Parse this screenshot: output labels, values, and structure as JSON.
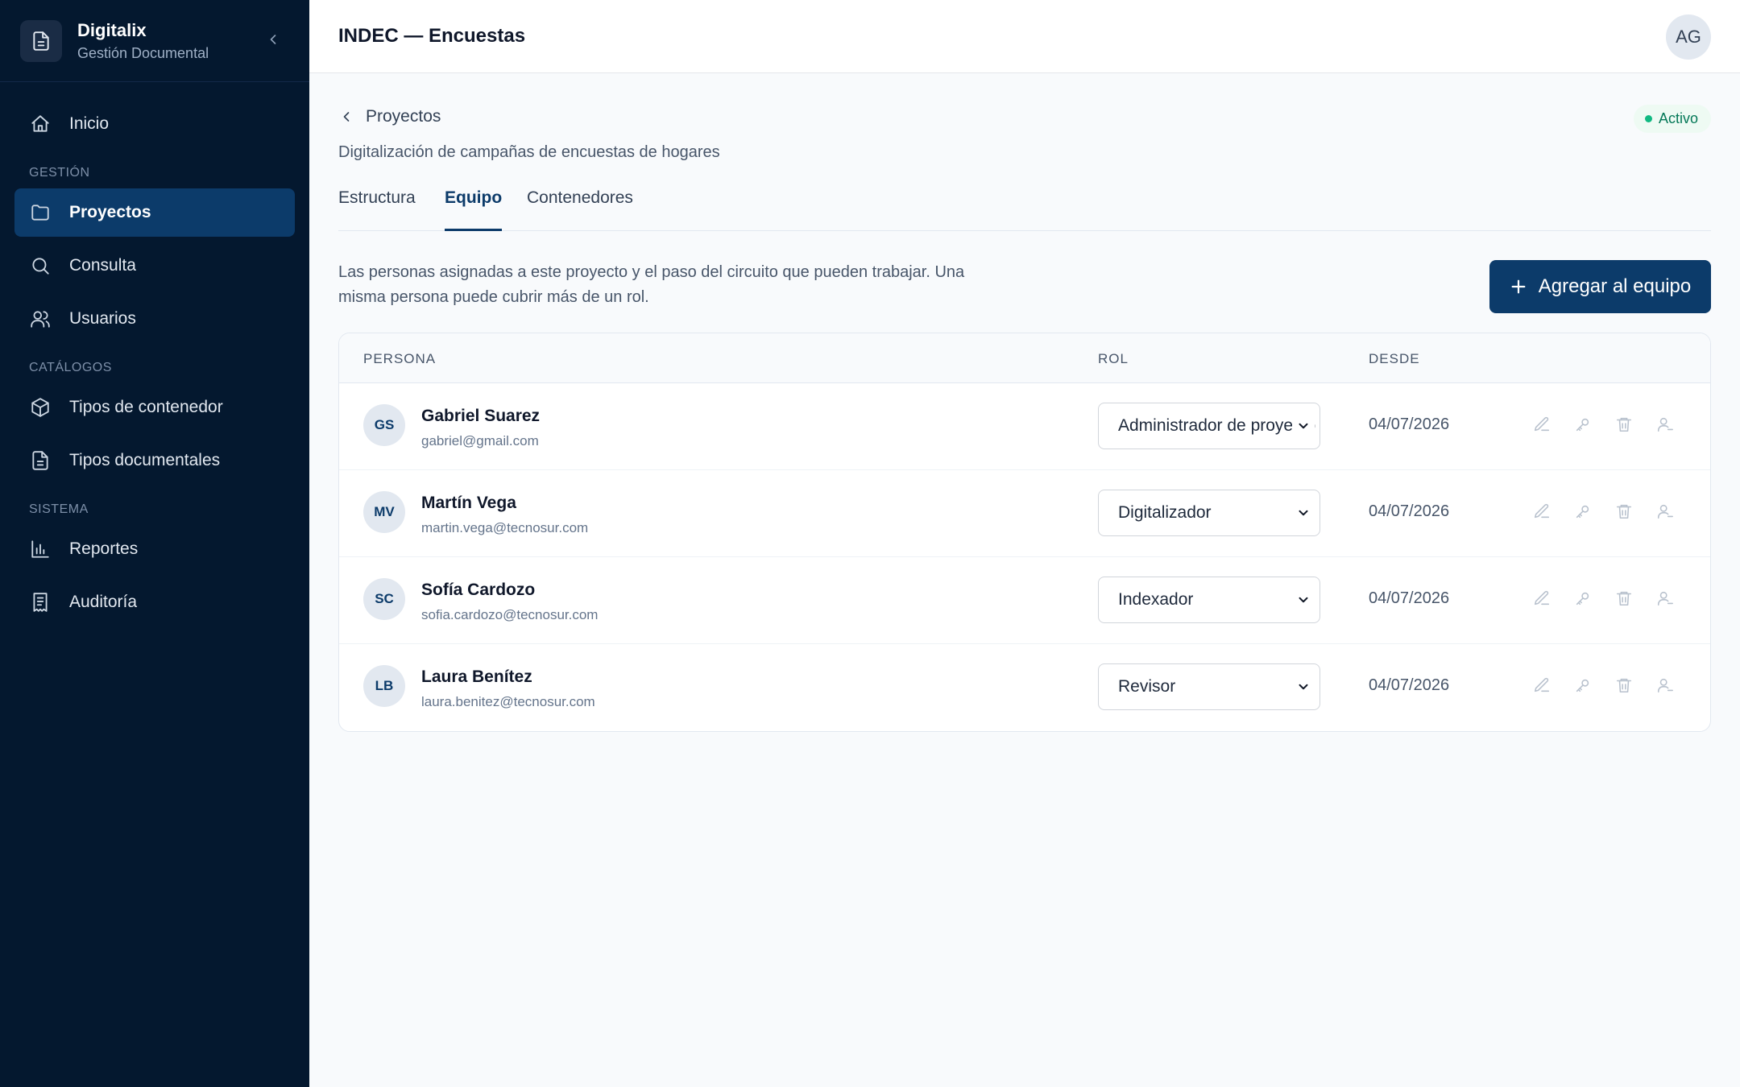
{
  "app": {
    "name": "Digitalix",
    "subtitle": "Gestión Documental"
  },
  "sidebar": {
    "items": [
      {
        "type": "item",
        "label": "Inicio",
        "icon": "home-icon",
        "active": false
      },
      {
        "type": "section",
        "label": "GESTIÓN"
      },
      {
        "type": "item",
        "label": "Proyectos",
        "icon": "folder-icon",
        "active": true
      },
      {
        "type": "item",
        "label": "Consulta",
        "icon": "search-icon",
        "active": false
      },
      {
        "type": "item",
        "label": "Usuarios",
        "icon": "users-icon",
        "active": false
      },
      {
        "type": "section",
        "label": "CATÁLOGOS"
      },
      {
        "type": "item",
        "label": "Tipos de contenedor",
        "icon": "box-icon",
        "active": false
      },
      {
        "type": "item",
        "label": "Tipos documentales",
        "icon": "document-icon",
        "active": false
      },
      {
        "type": "section",
        "label": "SISTEMA"
      },
      {
        "type": "item",
        "label": "Reportes",
        "icon": "bar-chart-icon",
        "active": false
      },
      {
        "type": "item",
        "label": "Auditoría",
        "icon": "receipt-icon",
        "active": false
      }
    ]
  },
  "header": {
    "title": "INDEC — Encuestas",
    "user_initials": "AG"
  },
  "project": {
    "back_label": "Proyectos",
    "status": "Activo",
    "description": "Digitalización de campañas de encuestas de hogares"
  },
  "tabs": [
    {
      "label": "Estructura",
      "active": false
    },
    {
      "label": "Equipo",
      "active": true
    },
    {
      "label": "Contenedores",
      "active": false
    }
  ],
  "team": {
    "intro": "Las personas asignadas a este proyecto y el paso del circuito que pueden trabajar. Una misma persona puede cubrir más de un rol.",
    "add_button": "Agregar al equipo",
    "columns": {
      "person": "PERSONA",
      "role": "ROL",
      "since": "DESDE"
    },
    "rows": [
      {
        "initials": "GS",
        "name": "Gabriel Suarez",
        "email": "gabriel@gmail.com",
        "role": "Administrador de proyecto",
        "since": "04/07/2026"
      },
      {
        "initials": "MV",
        "name": "Martín Vega",
        "email": "martin.vega@tecnosur.com",
        "role": "Digitalizador",
        "since": "04/07/2026"
      },
      {
        "initials": "SC",
        "name": "Sofía Cardozo",
        "email": "sofia.cardozo@tecnosur.com",
        "role": "Indexador",
        "since": "04/07/2026"
      },
      {
        "initials": "LB",
        "name": "Laura Benítez",
        "email": "laura.benitez@tecnosur.com",
        "role": "Revisor",
        "since": "04/07/2026"
      }
    ],
    "row_actions": [
      "edit-icon",
      "key-icon",
      "trash-icon",
      "remove-user-icon"
    ]
  },
  "colors": {
    "sidebar": "#04182f",
    "accent": "#0c3b6a",
    "status": "#047857"
  }
}
